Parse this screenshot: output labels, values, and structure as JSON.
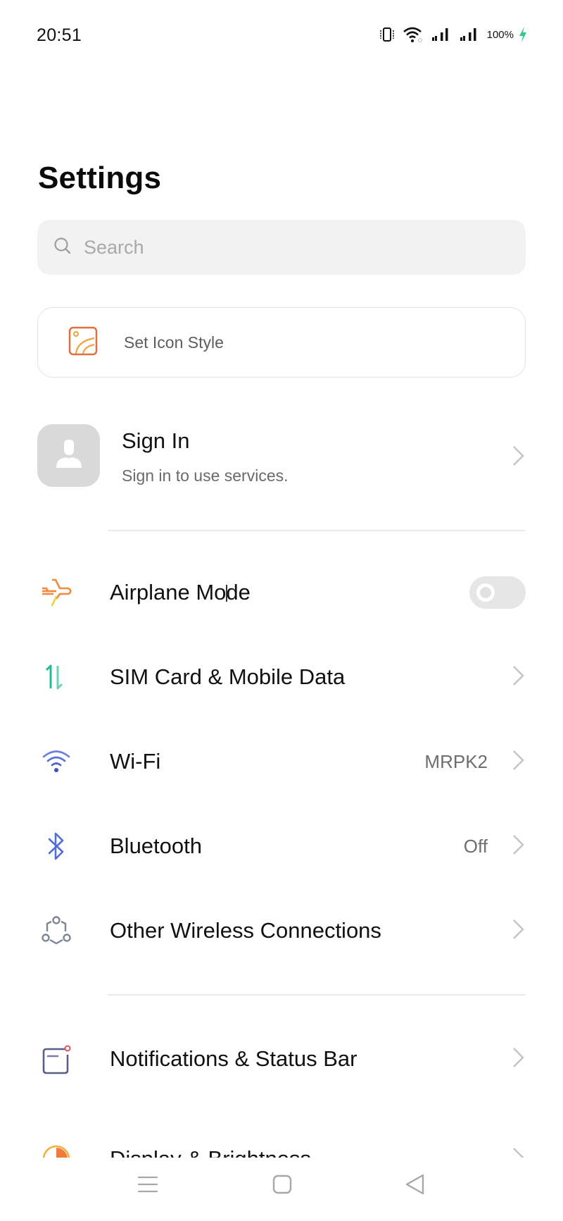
{
  "status_bar": {
    "time": "20:51",
    "battery_percent": "100%",
    "icons": [
      "vibrate-icon",
      "wifi-icon",
      "signal-sim1-icon",
      "signal-sim2-icon",
      "battery-charging-icon"
    ],
    "charging_color": "#2fc98a"
  },
  "header": {
    "title": "Settings"
  },
  "search": {
    "placeholder": "Search"
  },
  "icon_style_card": {
    "label": "Set Icon Style",
    "icon": "icon-style-icon",
    "accent": "#e0713a"
  },
  "account": {
    "title": "Sign In",
    "subtitle": "Sign in to use services.",
    "icon": "avatar-placeholder-icon"
  },
  "sections": [
    {
      "items": [
        {
          "label": "Airplane Mode",
          "icon": "airplane-icon",
          "control": "toggle",
          "toggle_on": false,
          "icon_color": "#f08a3e"
        },
        {
          "label": "SIM Card & Mobile Data",
          "icon": "mobile-data-icon",
          "control": "chevron",
          "icon_color": "#23b899"
        },
        {
          "label": "Wi-Fi",
          "icon": "wifi-icon",
          "value": "MRPK2",
          "control": "chevron",
          "icon_color": "#5b6ed8"
        },
        {
          "label": "Bluetooth",
          "icon": "bluetooth-icon",
          "value": "Off",
          "control": "chevron",
          "icon_color": "#4d6fd6"
        },
        {
          "label": "Other Wireless Connections",
          "icon": "connections-icon",
          "control": "chevron",
          "icon_color": "#7d8699"
        }
      ]
    },
    {
      "items": [
        {
          "label": "Notifications & Status Bar",
          "icon": "notification-icon",
          "control": "chevron",
          "icon_color": "#5b5f86"
        },
        {
          "label": "Display & Brightness",
          "icon": "brightness-icon",
          "control": "chevron",
          "icon_color": "#f07a3c"
        }
      ]
    }
  ],
  "nav_bar": {
    "buttons": [
      "menu-button",
      "home-button",
      "back-button"
    ]
  }
}
